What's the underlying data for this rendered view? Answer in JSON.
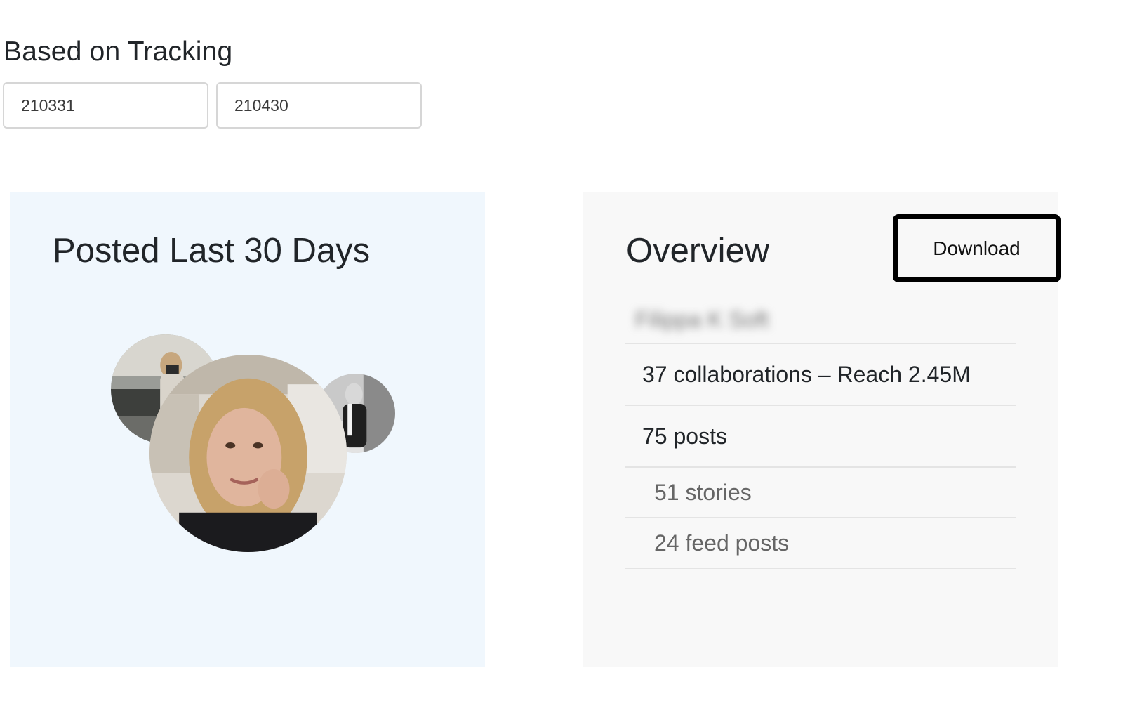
{
  "filter": {
    "title": "Based on Tracking",
    "date_from": "210331",
    "date_to": "210430"
  },
  "posted_card": {
    "title": "Posted Last 30 Days",
    "bubbles": [
      {
        "name": "influencer-avatar-left",
        "style": "color"
      },
      {
        "name": "influencer-avatar-right",
        "style": "grayscale"
      },
      {
        "name": "influencer-avatar-main",
        "style": "color"
      }
    ]
  },
  "overview": {
    "title": "Overview",
    "download_label": "Download",
    "name_redacted": "Filippa K Soft",
    "collaborations": "37 collaborations – Reach 2.45M",
    "posts": "75 posts",
    "stories": "51 stories",
    "feed_posts": "24 feed posts"
  },
  "colors": {
    "posted_card_bg": "#f0f7fd",
    "overview_card_bg": "#f8f8f8",
    "download_border": "#000000"
  }
}
